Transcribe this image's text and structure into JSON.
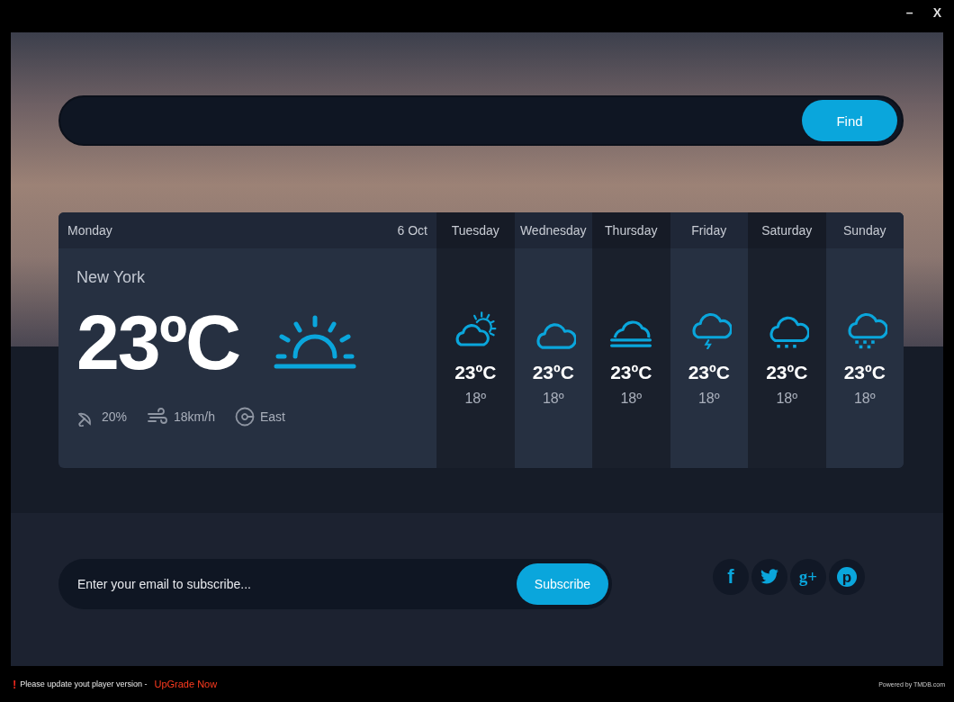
{
  "window": {
    "minimize": "–",
    "close": "X"
  },
  "search": {
    "button": "Find"
  },
  "today": {
    "day": "Monday",
    "date": "6 Oct",
    "city": "New York",
    "temperature": "23ºC",
    "kind": "sunrise",
    "rain": "20%",
    "wind": "18km/h",
    "direction": "East"
  },
  "forecast": [
    {
      "day": "Tuesday",
      "kind": "partly-cloudy",
      "temperature": "23ºC",
      "low": "18º"
    },
    {
      "day": "Wednesday",
      "kind": "cloudy",
      "temperature": "23ºC",
      "low": "18º"
    },
    {
      "day": "Thursday",
      "kind": "fog",
      "temperature": "23ºC",
      "low": "18º"
    },
    {
      "day": "Friday",
      "kind": "thunder",
      "temperature": "23ºC",
      "low": "18º"
    },
    {
      "day": "Saturday",
      "kind": "snow",
      "temperature": "23ºC",
      "low": "18º"
    },
    {
      "day": "Sunday",
      "kind": "heavy-snow",
      "temperature": "23ºC",
      "low": "18º"
    }
  ],
  "subscribe": {
    "placeholder": "Enter your email to subscribe...",
    "button": "Subscribe"
  },
  "social": [
    {
      "kind": "facebook",
      "glyph": "f"
    },
    {
      "kind": "twitter"
    },
    {
      "kind": "googleplus",
      "glyph": "g+"
    },
    {
      "kind": "pinterest",
      "glyph": "p"
    }
  ],
  "status_bar": {
    "alert": "!",
    "message": "Please update yout player version -",
    "link": "UpGrade Now",
    "credit": "Powered by TMDB.com"
  }
}
